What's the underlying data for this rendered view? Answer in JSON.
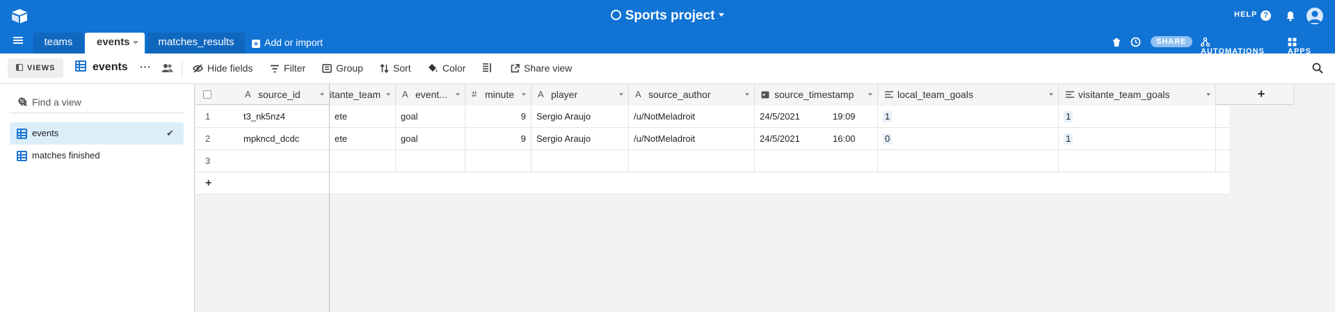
{
  "app": {
    "base_title": "Sports project",
    "help_label": "HELP"
  },
  "tabs": [
    {
      "label": "teams"
    },
    {
      "label": "events"
    },
    {
      "label": "matches_results"
    }
  ],
  "add_import_label": "Add or import",
  "right_tools": {
    "share_label": "SHARE",
    "automations_label": "AUTOMATIONS",
    "apps_label": "APPS"
  },
  "toolbar": {
    "views_label": "VIEWS",
    "view_name": "events",
    "hide_fields": "Hide fields",
    "filter": "Filter",
    "group": "Group",
    "sort": "Sort",
    "color": "Color",
    "share_view": "Share view"
  },
  "sidebar": {
    "find_placeholder": "Find a view",
    "views": [
      {
        "label": "events",
        "active": true
      },
      {
        "label": "matches finished",
        "active": false
      }
    ]
  },
  "columns": [
    {
      "label": "source_id",
      "type_icon": "A"
    },
    {
      "label": "itante_team",
      "type_icon": ""
    },
    {
      "label": "event...",
      "type_icon": "A"
    },
    {
      "label": "minute",
      "type_icon": "#"
    },
    {
      "label": "player",
      "type_icon": "A"
    },
    {
      "label": "source_author",
      "type_icon": "A"
    },
    {
      "label": "source_timestamp",
      "type_icon": "date"
    },
    {
      "label": "local_team_goals",
      "type_icon": "rating"
    },
    {
      "label": "visitante_team_goals",
      "type_icon": "rating"
    }
  ],
  "rows": [
    {
      "num": "1",
      "cells": [
        "t3_nk5nz4",
        "ete",
        "goal",
        "9",
        "Sergio Araujo",
        "/u/NotMeladroit",
        "24/5/2021",
        "19:09",
        "1",
        "1"
      ]
    },
    {
      "num": "2",
      "cells": [
        "mpkncd_dcdc",
        "ete",
        "goal",
        "9",
        "Sergio Araujo",
        "/u/NotMeladroit",
        "24/5/2021",
        "16:00",
        "0",
        "1"
      ]
    },
    {
      "num": "3",
      "cells": [
        "",
        "",
        "",
        "",
        "",
        "",
        "",
        "",
        "",
        ""
      ]
    }
  ],
  "add_row_label": "+",
  "add_column_label": "+"
}
